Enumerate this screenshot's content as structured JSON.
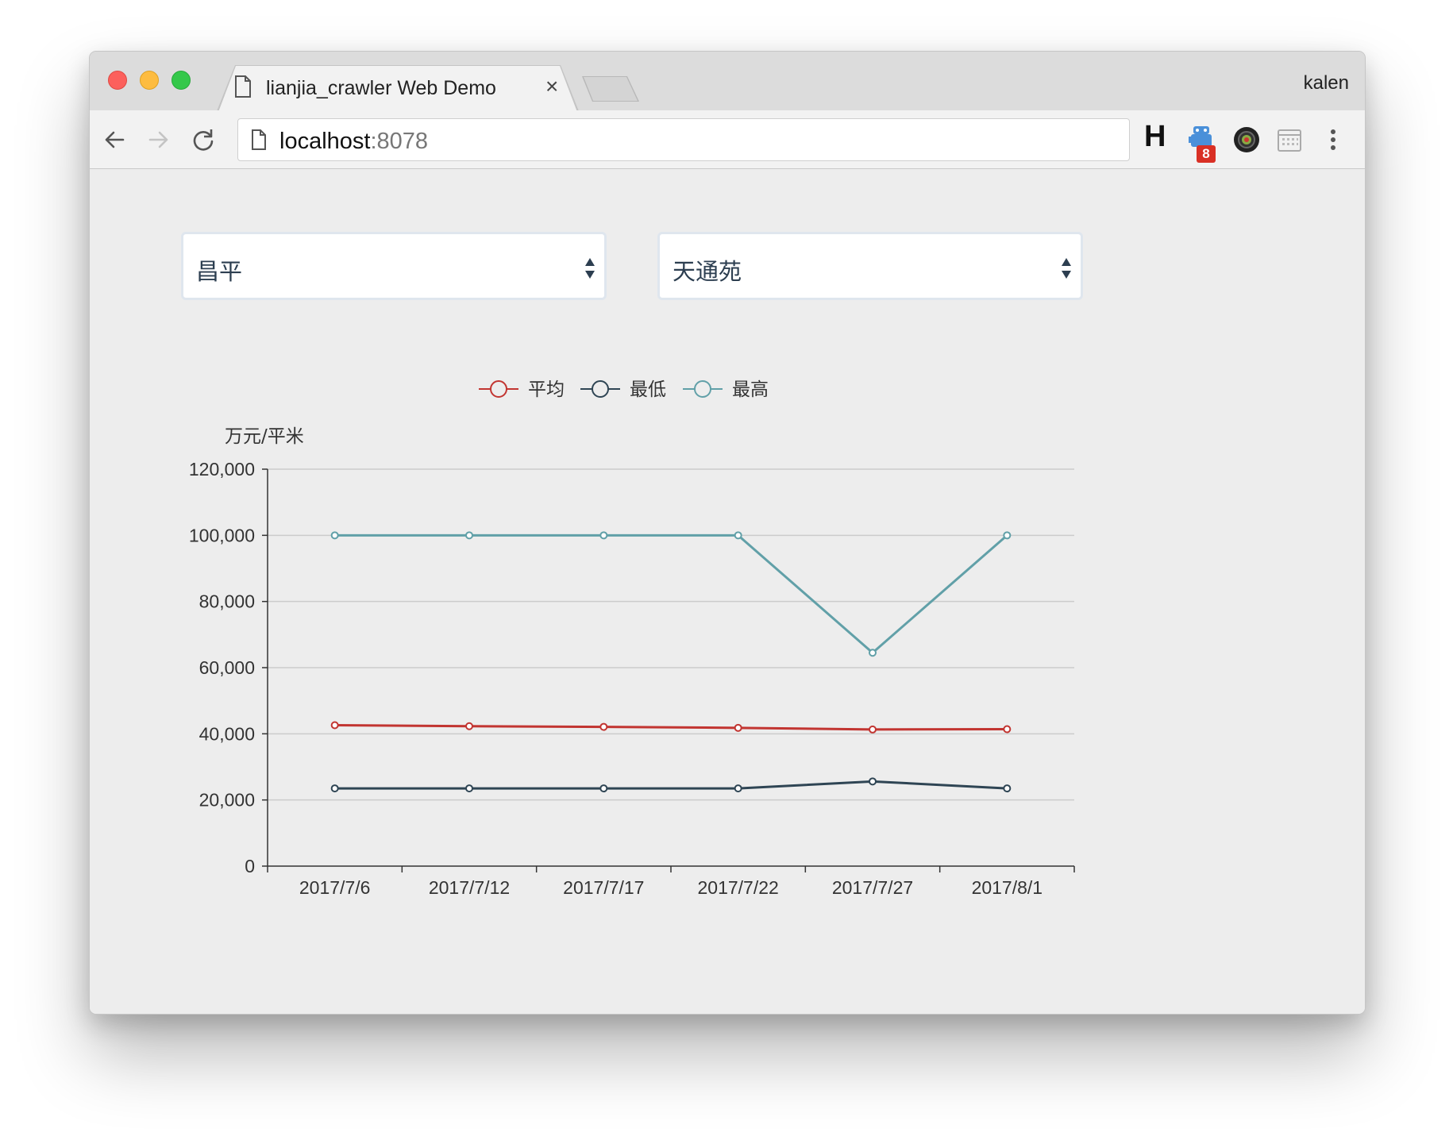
{
  "browser": {
    "tab_title": "lianjia_crawler Web Demo",
    "tab_close": "×",
    "profile_name": "kalen",
    "url_host": "localhost",
    "url_port": ":8078",
    "extension_h_label": "H",
    "extension_badge_count": "8"
  },
  "filters": {
    "district": "昌平",
    "community": "天通苑"
  },
  "colors": {
    "avg": "#c23531",
    "min": "#2f4554",
    "max": "#61a0a8"
  },
  "chart_data": {
    "type": "line",
    "ylabel": "万元/平米",
    "categories": [
      "2017/7/6",
      "2017/7/12",
      "2017/7/17",
      "2017/7/22",
      "2017/7/27",
      "2017/8/1"
    ],
    "ylim": [
      0,
      120000
    ],
    "yticks": [
      0,
      20000,
      40000,
      60000,
      80000,
      100000,
      120000
    ],
    "ytick_labels": [
      "0",
      "20,000",
      "40,000",
      "60,000",
      "80,000",
      "100,000",
      "120,000"
    ],
    "grid": true,
    "legend_position": "top-center",
    "series": [
      {
        "name": "平均",
        "color": "#c23531",
        "values": [
          42600,
          42300,
          42100,
          41800,
          41300,
          41400
        ]
      },
      {
        "name": "最低",
        "color": "#2f4554",
        "values": [
          23500,
          23500,
          23500,
          23500,
          25600,
          23500
        ]
      },
      {
        "name": "最高",
        "color": "#61a0a8",
        "values": [
          100000,
          100000,
          100000,
          100000,
          64500,
          100000
        ]
      }
    ]
  }
}
